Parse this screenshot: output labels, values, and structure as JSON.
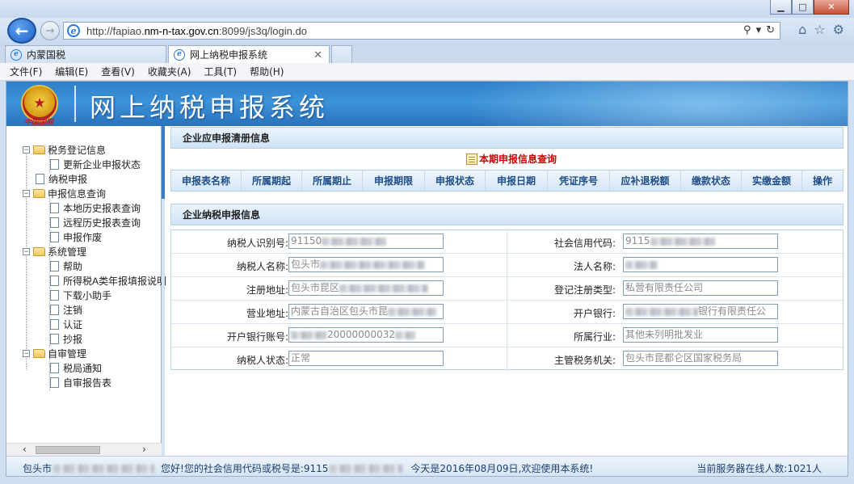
{
  "browser": {
    "url_prefix": "http://fapiao.",
    "url_domain": "nm-n-tax.gov.cn",
    "url_suffix": ":8099/js3q/login.do",
    "tabs": [
      {
        "label": "内蒙国税"
      },
      {
        "label": "网上纳税申报系统"
      }
    ],
    "menu": [
      "文件(F)",
      "编辑(E)",
      "查看(V)",
      "收藏夹(A)",
      "工具(T)",
      "帮助(H)"
    ]
  },
  "banner": {
    "title": "网上纳税申报系统",
    "emblem_caption": "中国国税"
  },
  "sidebar": {
    "items": [
      {
        "label": "税务登记信息",
        "type": "folder"
      },
      {
        "label": "更新企业申报状态",
        "type": "page"
      },
      {
        "label": "纳税申报",
        "type": "page"
      },
      {
        "label": "申报信息查询",
        "type": "folder"
      },
      {
        "label": "本地历史报表查询",
        "type": "page"
      },
      {
        "label": "远程历史报表查询",
        "type": "page"
      },
      {
        "label": "申报作废",
        "type": "page"
      },
      {
        "label": "系统管理",
        "type": "folder"
      },
      {
        "label": "帮助",
        "type": "page"
      },
      {
        "label": "所得税A类年报填报说明",
        "type": "page"
      },
      {
        "label": "下载小助手",
        "type": "page"
      },
      {
        "label": "注销",
        "type": "page"
      },
      {
        "label": "认证",
        "type": "page"
      },
      {
        "label": "抄报",
        "type": "page"
      },
      {
        "label": "自审管理",
        "type": "folder"
      },
      {
        "label": "税局通知",
        "type": "page"
      },
      {
        "label": "自审报告表",
        "type": "page"
      }
    ]
  },
  "declare_section": {
    "title": "企业应申报清册信息",
    "query_link": "本期申报信息查询",
    "columns": [
      "申报表名称",
      "所属期起",
      "所属期止",
      "申报期限",
      "申报状态",
      "申报日期",
      "凭证序号",
      "应补退税额",
      "缴款状态",
      "实缴金额",
      "操作"
    ]
  },
  "taxpayer_section": {
    "title": "企业纳税申报信息",
    "rows": [
      {
        "left_label": "纳税人识别号:",
        "left_value": "91150",
        "right_label": "社会信用代码:",
        "right_value": "9115"
      },
      {
        "left_label": "纳税人名称:",
        "left_value": "包头市",
        "right_label": "法人名称:",
        "right_value": ""
      },
      {
        "left_label": "注册地址:",
        "left_value": "包头市昆区",
        "right_label": "登记注册类型:",
        "right_value": "私营有限责任公司"
      },
      {
        "left_label": "营业地址:",
        "left_value": "内蒙古自治区包头市昆",
        "right_label": "开户银行:",
        "right_value": "银行有限责任公"
      },
      {
        "left_label": "开户银行账号:",
        "left_value": "20000000032",
        "right_label": "所属行业:",
        "right_value": "其他未列明批发业"
      },
      {
        "left_label": "纳税人状态:",
        "left_value": "正常",
        "right_label": "主管税务机关:",
        "right_value": "包头市昆都仑区国家税务局"
      }
    ]
  },
  "status": {
    "city": "包头市",
    "greeting": "您好!您的社会信用代码或税号是:9115",
    "date_text": "今天是2016年08月09日,欢迎使用本系统!",
    "online_label": "当前服务器在线人数:",
    "online_count": "1021人"
  }
}
